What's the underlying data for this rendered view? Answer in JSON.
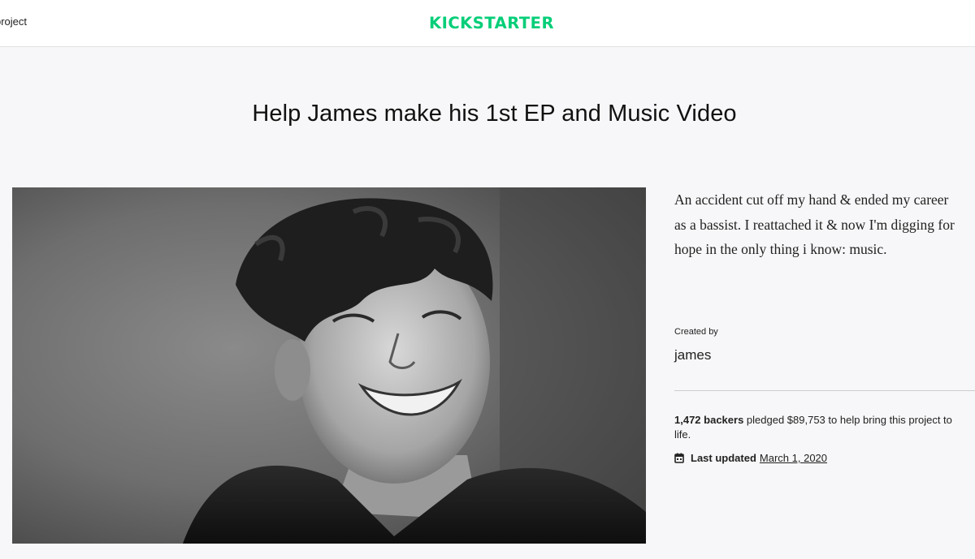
{
  "header": {
    "start_link": "project",
    "logo_text": "KICKSTARTER",
    "brand_color": "#05ce78"
  },
  "project": {
    "title": "Help James make his 1st EP and Music Video",
    "blurb": "An accident cut off my hand & ended my career as a bassist. I reattached it & now I'm digging for hope in the only thing i know: music.",
    "created_by_label": "Created by",
    "creator": "james",
    "stats": {
      "backers": "1,472 backers",
      "pledged_text_1": " pledged ",
      "amount": "$89,753",
      "pledged_text_2": " to help bring this project to life."
    },
    "updated": {
      "label": "Last updated",
      "date": "March 1, 2020",
      "icon": "calendar-icon"
    }
  }
}
